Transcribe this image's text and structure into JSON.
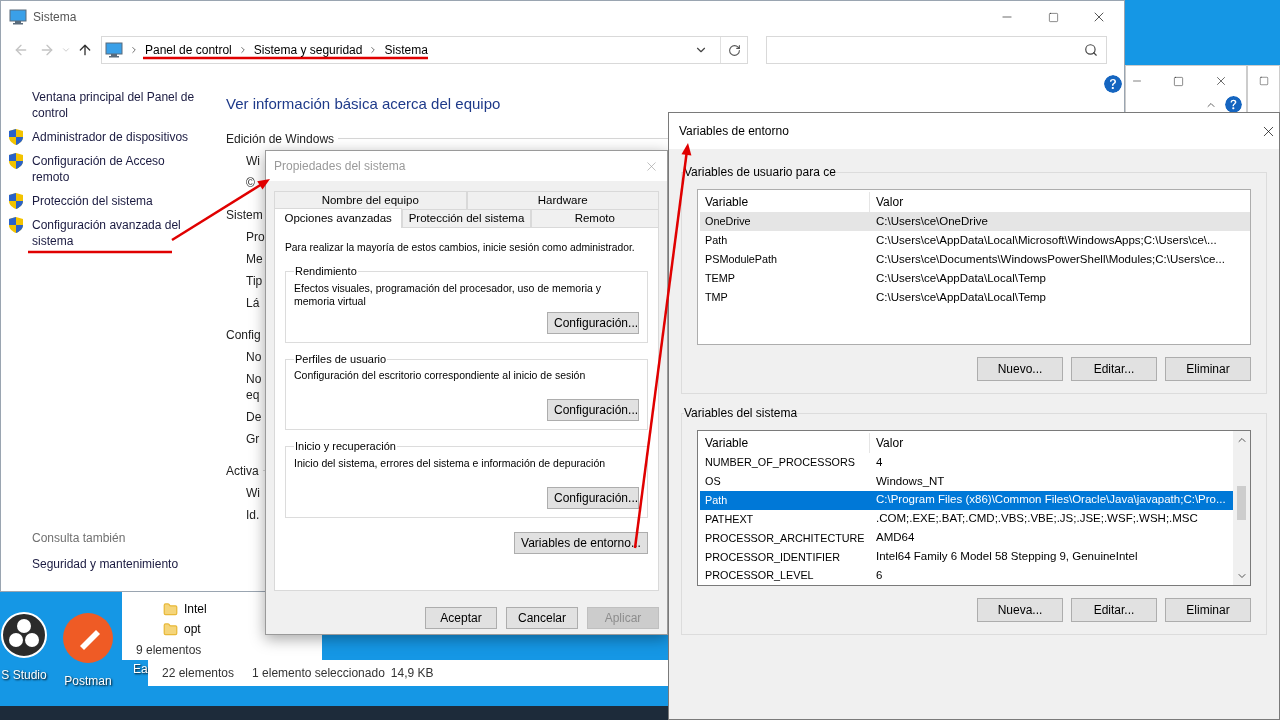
{
  "desktop_icons": [
    {
      "label": "S Studio",
      "kind": "obs"
    },
    {
      "label": "Postman",
      "kind": "postman"
    },
    {
      "label": "Ea",
      "kind": "generic"
    }
  ],
  "explorer_window": {
    "items": [
      "Intel",
      "opt"
    ],
    "status": "9 elementos"
  },
  "explorer_status": [
    "22 elementos",
    "1 elemento seleccionado",
    "14,9 KB"
  ],
  "system_window": {
    "title": "Sistema",
    "breadcrumbs": [
      "Panel de control",
      "Sistema y seguridad",
      "Sistema"
    ],
    "sidebar": [
      {
        "label": "Ventana principal del Panel de control",
        "shield": false
      },
      {
        "label": "Administrador de dispositivos",
        "shield": true
      },
      {
        "label": "Configuración de Acceso remoto",
        "shield": true
      },
      {
        "label": "Protección del sistema",
        "shield": true
      },
      {
        "label": "Configuración avanzada del sistema",
        "shield": true
      }
    ],
    "see_also_title": "Consulta también",
    "see_also": [
      "Seguridad y mantenimiento"
    ],
    "heading": "Ver información básica acerca del equipo",
    "details": [
      {
        "text": "Edición de Windows",
        "kind": "section"
      },
      {
        "text": "Wi",
        "kind": "item"
      },
      {
        "text": "©",
        "kind": "item"
      },
      {
        "text": "Sistem",
        "kind": "section"
      },
      {
        "text": "Pro",
        "kind": "item"
      },
      {
        "text": "Me",
        "kind": "item"
      },
      {
        "text": "Tip",
        "kind": "item"
      },
      {
        "text": "Lá",
        "kind": "item"
      },
      {
        "text": "Config",
        "kind": "section"
      },
      {
        "text": "No",
        "kind": "item"
      },
      {
        "text": "No",
        "kind": "item"
      },
      {
        "text": "eq",
        "kind": "wrap"
      },
      {
        "text": "De",
        "kind": "item"
      },
      {
        "text": "Gr",
        "kind": "item"
      },
      {
        "text": "Activa",
        "kind": "section"
      },
      {
        "text": "Wi",
        "kind": "item"
      },
      {
        "text": "Id.",
        "kind": "item"
      }
    ]
  },
  "system_properties": {
    "title": "Propiedades del sistema",
    "active": false,
    "tab_rows": [
      {
        "tabs": [
          {
            "label": "Nombre del equipo",
            "selected": false
          },
          {
            "label": "Hardware",
            "selected": false
          }
        ]
      },
      {
        "tabs": [
          {
            "label": "Opciones avanzadas",
            "selected": true
          },
          {
            "label": "Protección del sistema",
            "selected": false
          },
          {
            "label": "Remoto",
            "selected": false
          }
        ]
      }
    ],
    "notice": "Para realizar la mayoría de estos cambios, inicie sesión como administrador.",
    "groups": [
      {
        "title": "Rendimiento",
        "description": "Efectos visuales, programación del procesador, uso de memoria y memoria virtual",
        "button": "Configuración..."
      },
      {
        "title": "Perfiles de usuario",
        "description": "Configuración del escritorio correspondiente al inicio de sesión",
        "button": "Configuración..."
      },
      {
        "title": "Inicio y recuperación",
        "description": "Inicio del sistema, errores del sistema e información de depuración",
        "button": "Configuración..."
      }
    ],
    "env_button": "Variables de entorno...",
    "buttons": [
      {
        "label": "Aceptar",
        "disabled": false
      },
      {
        "label": "Cancelar",
        "disabled": false
      },
      {
        "label": "Aplicar",
        "disabled": true
      }
    ]
  },
  "environment_variables": {
    "title": "Variables de entorno",
    "lists": [
      {
        "title": "Variables de usuario para ce",
        "focused": false,
        "scrollbar": false,
        "columns": [
          "Variable",
          "Valor"
        ],
        "rows": [
          {
            "name": "OneDrive",
            "value": "C:\\Users\\ce\\OneDrive",
            "selected": true
          },
          {
            "name": "Path",
            "value": "C:\\Users\\ce\\AppData\\Local\\Microsoft\\WindowsApps;C:\\Users\\ce\\...",
            "selected": false
          },
          {
            "name": "PSModulePath",
            "value": "C:\\Users\\ce\\Documents\\WindowsPowerShell\\Modules;C:\\Users\\ce...",
            "selected": false
          },
          {
            "name": "TEMP",
            "value": "C:\\Users\\ce\\AppData\\Local\\Temp",
            "selected": false
          },
          {
            "name": "TMP",
            "value": "C:\\Users\\ce\\AppData\\Local\\Temp",
            "selected": false
          }
        ],
        "buttons": [
          "Nuevo...",
          "Editar...",
          "Eliminar"
        ]
      },
      {
        "title": "Variables del sistema",
        "focused": true,
        "scrollbar": true,
        "columns": [
          "Variable",
          "Valor"
        ],
        "rows": [
          {
            "name": "NUMBER_OF_PROCESSORS",
            "value": "4",
            "selected": false
          },
          {
            "name": "OS",
            "value": "Windows_NT",
            "selected": false
          },
          {
            "name": "Path",
            "value": "C:\\Program Files (x86)\\Common Files\\Oracle\\Java\\javapath;C:\\Pro...",
            "selected": true
          },
          {
            "name": "PATHEXT",
            "value": ".COM;.EXE;.BAT;.CMD;.VBS;.VBE;.JS;.JSE;.WSF;.WSH;.MSC",
            "selected": false
          },
          {
            "name": "PROCESSOR_ARCHITECTURE",
            "value": "AMD64",
            "selected": false
          },
          {
            "name": "PROCESSOR_IDENTIFIER",
            "value": "Intel64 Family 6 Model 58 Stepping 9, GenuineIntel",
            "selected": false
          },
          {
            "name": "PROCESSOR_LEVEL",
            "value": "6",
            "selected": false
          }
        ],
        "buttons": [
          "Nueva...",
          "Editar...",
          "Eliminar"
        ]
      }
    ]
  }
}
